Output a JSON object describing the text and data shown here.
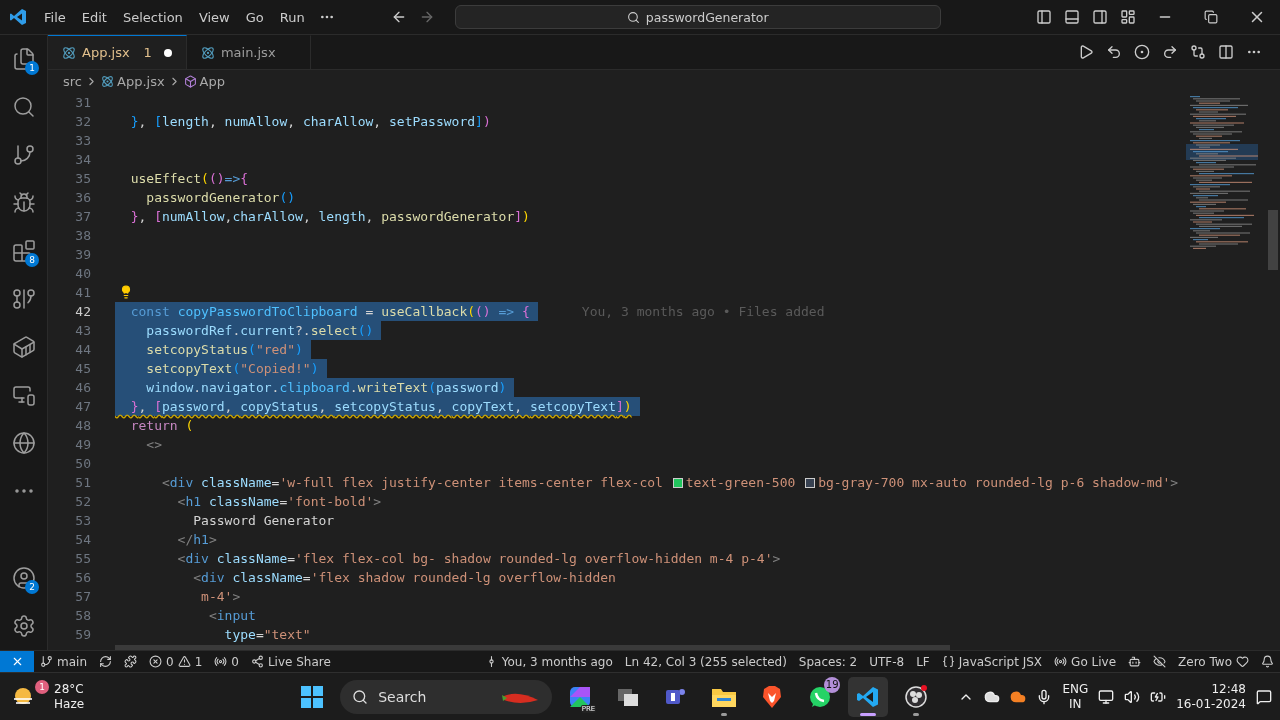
{
  "title_bar": {
    "menus": [
      "File",
      "Edit",
      "Selection",
      "View",
      "Go",
      "Run"
    ],
    "command_center": {
      "value": "passwordGenerator"
    }
  },
  "activity_bar": {
    "top": [
      {
        "kind": "explorer",
        "badge": "1"
      },
      {
        "kind": "search"
      },
      {
        "kind": "source-control"
      },
      {
        "kind": "run-debug"
      },
      {
        "kind": "extensions",
        "badge": "8"
      },
      {
        "kind": "git-graph"
      },
      {
        "kind": "docker"
      },
      {
        "kind": "remote"
      },
      {
        "kind": "browser"
      },
      {
        "kind": "more"
      }
    ],
    "bottom": [
      {
        "kind": "accounts",
        "badge": "2"
      },
      {
        "kind": "settings"
      }
    ]
  },
  "tabs": [
    {
      "label": "App.jsx",
      "selected": true,
      "problems": "1",
      "modified": true
    },
    {
      "label": "main.jsx",
      "selected": false,
      "modified": false
    }
  ],
  "breadcrumbs": [
    {
      "kind": "folder",
      "label": "src"
    },
    {
      "kind": "file",
      "label": "App.jsx"
    },
    {
      "kind": "component",
      "label": "App"
    }
  ],
  "editor": {
    "lines": [
      {
        "number": "31",
        "selected": false,
        "current": false,
        "warning": false,
        "lightbulb": false
      },
      {
        "number": "32",
        "selected": false,
        "current": false,
        "warning": false,
        "lightbulb": false,
        "tokens": [
          {
            "kind": "br3",
            "text": "  }"
          },
          {
            "kind": "plain",
            "text": ", "
          },
          {
            "kind": "br3",
            "text": "["
          },
          {
            "kind": "var",
            "text": "length"
          },
          {
            "kind": "plain",
            "text": ", "
          },
          {
            "kind": "var",
            "text": "numAllow"
          },
          {
            "kind": "plain",
            "text": ", "
          },
          {
            "kind": "var",
            "text": "charAllow"
          },
          {
            "kind": "plain",
            "text": ", "
          },
          {
            "kind": "var",
            "text": "setPassword"
          },
          {
            "kind": "br3",
            "text": "]"
          },
          {
            "kind": "br2",
            "text": ")"
          }
        ]
      },
      {
        "number": "33",
        "selected": false,
        "current": false,
        "warning": false,
        "lightbulb": false
      },
      {
        "number": "34",
        "selected": false,
        "current": false,
        "warning": false,
        "lightbulb": false
      },
      {
        "number": "35",
        "selected": false,
        "current": false,
        "warning": false,
        "lightbulb": false,
        "tokens": [
          {
            "kind": "fn",
            "text": "  useEffect"
          },
          {
            "kind": "br1",
            "text": "("
          },
          {
            "kind": "br2",
            "text": "()"
          },
          {
            "kind": "kw",
            "text": "=>"
          },
          {
            "kind": "br2",
            "text": "{"
          }
        ]
      },
      {
        "number": "36",
        "selected": false,
        "current": false,
        "warning": false,
        "lightbulb": false,
        "tokens": [
          {
            "kind": "fn",
            "text": "    passwordGenerator"
          },
          {
            "kind": "br3",
            "text": "()"
          }
        ]
      },
      {
        "number": "37",
        "selected": false,
        "current": false,
        "warning": false,
        "lightbulb": false,
        "tokens": [
          {
            "kind": "br2",
            "text": "  }"
          },
          {
            "kind": "plain",
            "text": ", "
          },
          {
            "kind": "br2",
            "text": "["
          },
          {
            "kind": "var",
            "text": "numAllow"
          },
          {
            "kind": "plain",
            "text": ","
          },
          {
            "kind": "var",
            "text": "charAllow"
          },
          {
            "kind": "plain",
            "text": ", "
          },
          {
            "kind": "var",
            "text": "length"
          },
          {
            "kind": "plain",
            "text": ", "
          },
          {
            "kind": "fn",
            "text": "passwordGenerator"
          },
          {
            "kind": "br2",
            "text": "]"
          },
          {
            "kind": "br1",
            "text": ")"
          }
        ]
      },
      {
        "number": "38",
        "selected": false,
        "current": false,
        "warning": false,
        "lightbulb": false
      },
      {
        "number": "39",
        "selected": false,
        "current": false,
        "warning": false,
        "lightbulb": false
      },
      {
        "number": "40",
        "selected": false,
        "current": false,
        "warning": false,
        "lightbulb": false
      },
      {
        "number": "41",
        "selected": false,
        "current": false,
        "warning": false,
        "lightbulb": true
      },
      {
        "number": "42",
        "selected": true,
        "current": true,
        "warning": false,
        "lightbulb": false,
        "blame": "You, 3 months ago • Files added",
        "tokens": [
          {
            "kind": "kw",
            "text": "  const "
          },
          {
            "kind": "const",
            "text": "copyPasswordToClipboard"
          },
          {
            "kind": "plain",
            "text": " = "
          },
          {
            "kind": "fn",
            "text": "useCallback"
          },
          {
            "kind": "br1",
            "text": "("
          },
          {
            "kind": "br2",
            "text": "()"
          },
          {
            "kind": "kw",
            "text": " => "
          },
          {
            "kind": "br2",
            "text": "{"
          }
        ]
      },
      {
        "number": "43",
        "selected": true,
        "current": false,
        "warning": false,
        "lightbulb": false,
        "tokens": [
          {
            "kind": "var",
            "text": "    passwordRef"
          },
          {
            "kind": "plain",
            "text": "."
          },
          {
            "kind": "var",
            "text": "current"
          },
          {
            "kind": "plain",
            "text": "?."
          },
          {
            "kind": "fn",
            "text": "select"
          },
          {
            "kind": "br3",
            "text": "()"
          }
        ]
      },
      {
        "number": "44",
        "selected": true,
        "current": false,
        "warning": false,
        "lightbulb": false,
        "tokens": [
          {
            "kind": "fn",
            "text": "    setcopyStatus"
          },
          {
            "kind": "br3",
            "text": "("
          },
          {
            "kind": "str",
            "text": "\"red\""
          },
          {
            "kind": "br3",
            "text": ")"
          }
        ]
      },
      {
        "number": "45",
        "selected": true,
        "current": false,
        "warning": false,
        "lightbulb": false,
        "tokens": [
          {
            "kind": "fn",
            "text": "    setcopyText"
          },
          {
            "kind": "br3",
            "text": "("
          },
          {
            "kind": "str",
            "text": "\"Copied!\""
          },
          {
            "kind": "br3",
            "text": ")"
          }
        ]
      },
      {
        "number": "46",
        "selected": true,
        "current": false,
        "warning": false,
        "lightbulb": false,
        "tokens": [
          {
            "kind": "var",
            "text": "    window"
          },
          {
            "kind": "plain",
            "text": "."
          },
          {
            "kind": "var",
            "text": "navigator"
          },
          {
            "kind": "plain",
            "text": "."
          },
          {
            "kind": "const",
            "text": "clipboard"
          },
          {
            "kind": "plain",
            "text": "."
          },
          {
            "kind": "fn",
            "text": "writeText"
          },
          {
            "kind": "br3",
            "text": "("
          },
          {
            "kind": "var",
            "text": "password"
          },
          {
            "kind": "br3",
            "text": ")"
          }
        ]
      },
      {
        "number": "47",
        "selected": true,
        "current": false,
        "warning": true,
        "lightbulb": false,
        "tokens": [
          {
            "kind": "br2",
            "text": "  }"
          },
          {
            "kind": "plain",
            "text": ", "
          },
          {
            "kind": "br2",
            "text": "["
          },
          {
            "kind": "var",
            "text": "password"
          },
          {
            "kind": "plain",
            "text": ", "
          },
          {
            "kind": "var",
            "text": "copyStatus"
          },
          {
            "kind": "plain",
            "text": ", "
          },
          {
            "kind": "var",
            "text": "setcopyStatus"
          },
          {
            "kind": "plain",
            "text": ", "
          },
          {
            "kind": "var",
            "text": "copyText"
          },
          {
            "kind": "plain",
            "text": ", "
          },
          {
            "kind": "var",
            "text": "setcopyText"
          },
          {
            "kind": "br2",
            "text": "]"
          },
          {
            "kind": "br1",
            "text": ")"
          }
        ]
      },
      {
        "number": "48",
        "selected": false,
        "current": false,
        "warning": false,
        "lightbulb": false,
        "tokens": [
          {
            "kind": "ctrl",
            "text": "  return "
          },
          {
            "kind": "br1",
            "text": "("
          }
        ]
      },
      {
        "number": "49",
        "selected": false,
        "current": false,
        "warning": false,
        "lightbulb": false,
        "tokens": [
          {
            "kind": "punct",
            "text": "    <>"
          }
        ]
      },
      {
        "number": "50",
        "selected": false,
        "current": false,
        "warning": false,
        "lightbulb": false
      },
      {
        "number": "51",
        "selected": false,
        "current": false,
        "warning": false,
        "lightbulb": false,
        "tokens": [
          {
            "kind": "punct",
            "text": "      <"
          },
          {
            "kind": "tag",
            "text": "div "
          },
          {
            "kind": "attr",
            "text": "className"
          },
          {
            "kind": "plain",
            "text": "="
          },
          {
            "kind": "str",
            "text": "'w-full flex justify-center items-center flex-col "
          },
          {
            "kind": "swatch",
            "color": "#22c55e"
          },
          {
            "kind": "str",
            "text": "text-green-500 "
          },
          {
            "kind": "swatch",
            "color": "#374151"
          },
          {
            "kind": "str",
            "text": "bg-gray-700 mx-auto rounded-lg p-6 shadow-md'"
          },
          {
            "kind": "punct",
            "text": ">"
          }
        ]
      },
      {
        "number": "52",
        "selected": false,
        "current": false,
        "warning": false,
        "lightbulb": false,
        "tokens": [
          {
            "kind": "punct",
            "text": "        <"
          },
          {
            "kind": "tag",
            "text": "h1 "
          },
          {
            "kind": "attr",
            "text": "className"
          },
          {
            "kind": "plain",
            "text": "="
          },
          {
            "kind": "str",
            "text": "'font-bold'"
          },
          {
            "kind": "punct",
            "text": ">"
          }
        ]
      },
      {
        "number": "53",
        "selected": false,
        "current": false,
        "warning": false,
        "lightbulb": false,
        "tokens": [
          {
            "kind": "plain",
            "text": "          Password Generator"
          }
        ]
      },
      {
        "number": "54",
        "selected": false,
        "current": false,
        "warning": false,
        "lightbulb": false,
        "tokens": [
          {
            "kind": "punct",
            "text": "        </"
          },
          {
            "kind": "tag",
            "text": "h1"
          },
          {
            "kind": "punct",
            "text": ">"
          }
        ]
      },
      {
        "number": "55",
        "selected": false,
        "current": false,
        "warning": false,
        "lightbulb": false,
        "tokens": [
          {
            "kind": "punct",
            "text": "        <"
          },
          {
            "kind": "tag",
            "text": "div "
          },
          {
            "kind": "attr",
            "text": "className"
          },
          {
            "kind": "plain",
            "text": "="
          },
          {
            "kind": "str",
            "text": "'flex flex-col bg- shadow rounded-lg overflow-hidden m-4 p-4'"
          },
          {
            "kind": "punct",
            "text": ">"
          }
        ]
      },
      {
        "number": "56",
        "selected": false,
        "current": false,
        "warning": false,
        "lightbulb": false,
        "tokens": [
          {
            "kind": "punct",
            "text": "          <"
          },
          {
            "kind": "tag",
            "text": "div "
          },
          {
            "kind": "attr",
            "text": "className"
          },
          {
            "kind": "plain",
            "text": "="
          },
          {
            "kind": "str",
            "text": "'flex shadow rounded-lg overflow-hidden"
          }
        ]
      },
      {
        "number": "57",
        "selected": false,
        "current": false,
        "warning": false,
        "lightbulb": false,
        "tokens": [
          {
            "kind": "str",
            "text": "           m-4'"
          },
          {
            "kind": "punct",
            "text": ">"
          }
        ]
      },
      {
        "number": "58",
        "selected": false,
        "current": false,
        "warning": false,
        "lightbulb": false,
        "tokens": [
          {
            "kind": "punct",
            "text": "            <"
          },
          {
            "kind": "tag",
            "text": "input"
          }
        ]
      },
      {
        "number": "59",
        "selected": false,
        "current": false,
        "warning": false,
        "lightbulb": false,
        "tokens": [
          {
            "kind": "attr",
            "text": "              type"
          },
          {
            "kind": "plain",
            "text": "="
          },
          {
            "kind": "str",
            "text": "\"text\""
          }
        ]
      }
    ]
  },
  "status_bar": {
    "left": [
      {
        "kind": "remote"
      },
      {
        "kind": "branch",
        "text": "main"
      },
      {
        "kind": "sync"
      },
      {
        "kind": "extension"
      },
      {
        "kind": "problems",
        "errors": "0",
        "warnings": "1"
      },
      {
        "kind": "ports",
        "text": "0"
      },
      {
        "kind": "live-share",
        "text": "Live Share"
      }
    ],
    "right": [
      {
        "kind": "blame",
        "text": "You, 3 months ago"
      },
      {
        "kind": "plain",
        "text": "Ln 42, Col 3 (255 selected)"
      },
      {
        "kind": "plain",
        "text": "Spaces: 2"
      },
      {
        "kind": "plain",
        "text": "UTF-8"
      },
      {
        "kind": "plain",
        "text": "LF"
      },
      {
        "kind": "language",
        "text": "JavaScript JSX"
      },
      {
        "kind": "go-live",
        "text": "Go Live"
      },
      {
        "kind": "copilot"
      },
      {
        "kind": "hidden"
      },
      {
        "kind": "heart",
        "text": "Zero Two"
      },
      {
        "kind": "bell"
      }
    ]
  },
  "taskbar": {
    "weather": {
      "badge": "1",
      "temperature": "28°C",
      "condition": "Haze"
    },
    "search": {
      "placeholder": "Search"
    },
    "apps": [
      {
        "kind": "copilot",
        "tag": "PRE",
        "selected": false,
        "running": false
      },
      {
        "kind": "task-view",
        "selected": false,
        "running": false
      },
      {
        "kind": "teams",
        "selected": false,
        "running": false
      },
      {
        "kind": "explorer",
        "selected": false,
        "running": true
      },
      {
        "kind": "brave",
        "selected": false,
        "running": false
      },
      {
        "kind": "whatsapp",
        "badge": "19",
        "selected": false,
        "running": false
      },
      {
        "kind": "vscode",
        "selected": true,
        "running": true
      },
      {
        "kind": "obs",
        "selected": false,
        "running": true
      }
    ],
    "tray": {
      "language": "ENG",
      "region": "IN",
      "time": "12:48",
      "date": "16-01-2024"
    }
  }
}
